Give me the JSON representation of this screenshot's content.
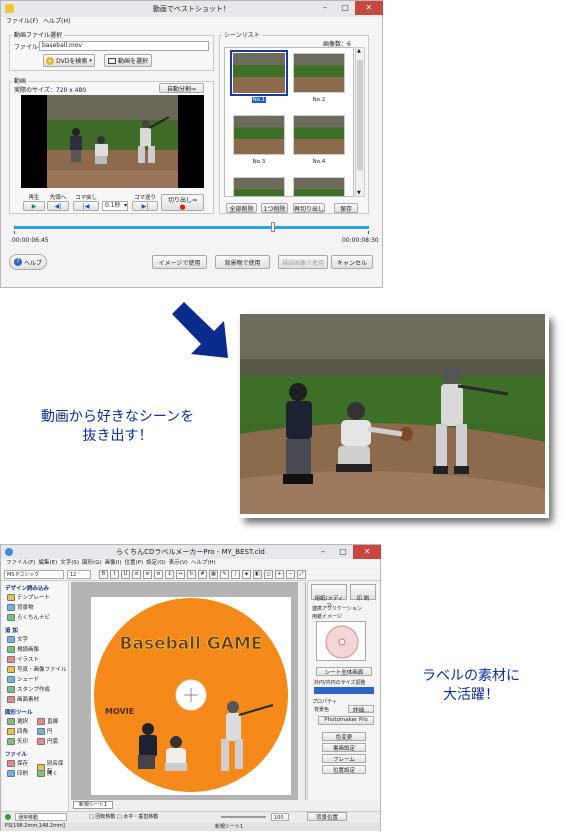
{
  "window1": {
    "title": "動画でベストショット！",
    "menu": [
      "ファイル(F)",
      "ヘルプ(H)"
    ],
    "file_group": {
      "label": "動画ファイル選択",
      "filename_label": "ファイル名",
      "filename_value": "baseball.mov",
      "dvd_button": "DVDを検索",
      "select_video_button": "動画を選択"
    },
    "video_group": {
      "label": "動画",
      "actual_size": "実際のサイズ：720 x 480",
      "auto_split_button": "自動分割⇒",
      "controls": [
        {
          "label": "再生",
          "icon": "▶"
        },
        {
          "label": "先頭へ",
          "icon": "◀|"
        },
        {
          "label": "コマ戻し",
          "icon": "|◀"
        },
        {
          "label": "コマ送り",
          "icon": "▶|"
        }
      ],
      "step_value": "0.1秒",
      "cut_button": "切り出し⇒",
      "time_start": "00:00:06:45",
      "time_end": "00:00:08:30",
      "slider_position": 0.73
    },
    "scene_list": {
      "label": "シーンリスト",
      "count_text": "画像数：6",
      "thumbnails": [
        "No.1",
        "No.2",
        "No.3",
        "No.4",
        "",
        ""
      ],
      "selected_index": 0,
      "buttons": [
        "全部削除",
        "1つ削除",
        "再切り出し",
        "保存"
      ]
    },
    "bottom": {
      "help_button": "ヘルプ",
      "use_image_button": "イメージで使用",
      "use_background_button": "背景物で使用",
      "use_label_button": "規読画像で使用",
      "cancel_button": "キャンセル"
    }
  },
  "caption1": [
    "動画から好きなシーンを",
    "抜き出す！"
  ],
  "caption2": [
    "ラベルの素材に",
    "大活躍！"
  ],
  "window2": {
    "title": "らくちんCDラベルメーカーPro - MY_BEST.cld",
    "menu": [
      "ファイル(F)",
      "編集(E)",
      "文字(S)",
      "図形(G)",
      "画像(I)",
      "位置(P)",
      "設定(O)",
      "表示(V)",
      "ヘルプ(H)"
    ],
    "font_value": "MS Pゴシック",
    "font_size": "12",
    "sidebar": {
      "sections": [
        {
          "title": "デザイン読み込み",
          "items": [
            "テンプレート",
            "背景物",
            "らくちんナビ"
          ]
        },
        {
          "title": "追 加",
          "items": [
            "文字",
            "規読画像",
            "イラスト",
            "写真・画像ファイル",
            "シェード",
            "スタンプ作成",
            "画面素材"
          ]
        },
        {
          "title": "図形ツール",
          "items": [
            "選択",
            "直線",
            "四角",
            "円",
            "矢印",
            "円弧"
          ]
        },
        {
          "title": "ファイル",
          "items": [
            "保存",
            "別名保存",
            "印刷",
            "開く"
          ]
        }
      ]
    },
    "disc": {
      "title_text": "Baseball GAME",
      "movie_text": "MOVIE",
      "color": "#f58a1a"
    },
    "sheet_tab": "新規シート1",
    "right_panel": {
      "print_btn": "用紙/メディア",
      "pdf_btn": "印 刷",
      "app_label": "連携アプリケーション",
      "media_label": "用紙イメージ",
      "sheet_label_btn": "シート全体画面",
      "sample_label": "外円/内円のサイズ調整",
      "property_label": "プロパティ",
      "edit_btn1": "背景色",
      "detail_btn": "詳細...",
      "photomaker_btn": "Photomaker Pro",
      "props": [
        "色変更",
        "書画設定",
        "フレーム",
        "位置設定"
      ]
    },
    "status_left": "通常移動",
    "status_check1": "回転移動",
    "status_check2": "水平・垂直移動",
    "zoom_value": "100",
    "bg_position_btn": "背景位置",
    "status_coords": "PS[198.2mm,148.2mm]",
    "status_sheet": "新規シート1"
  }
}
